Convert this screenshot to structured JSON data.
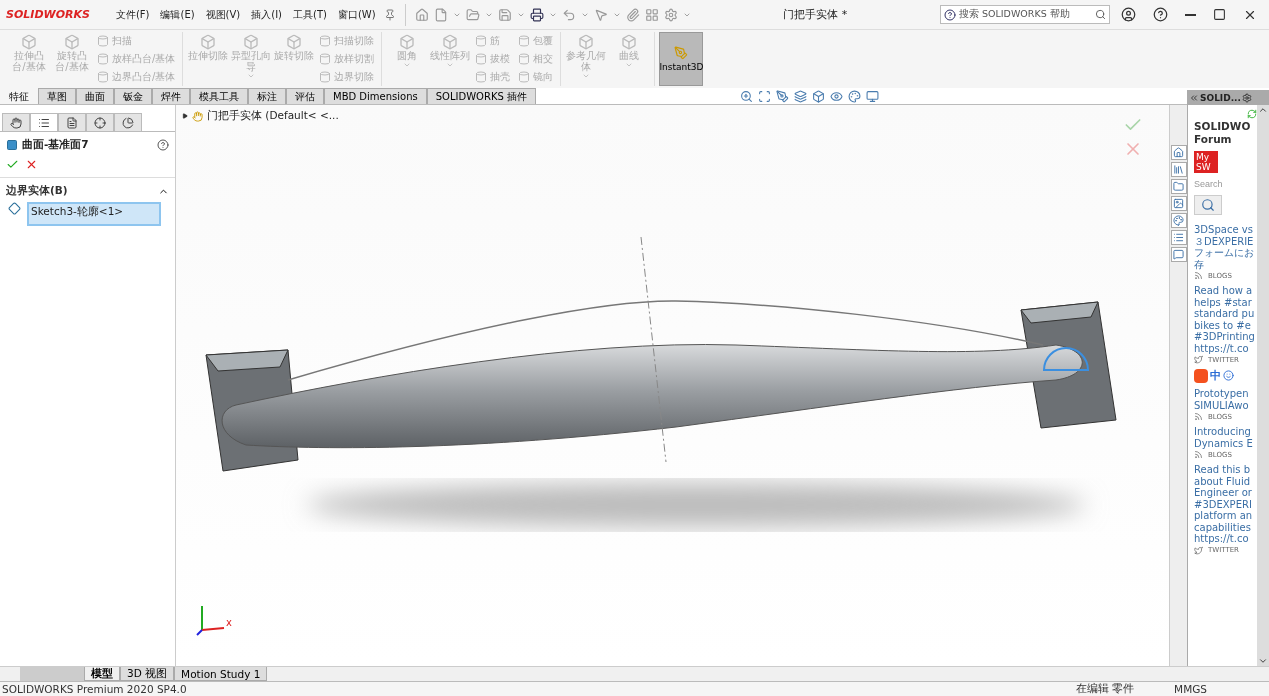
{
  "title_bar": {
    "logo": "SOLIDWORKS",
    "menus": [
      "文件(F)",
      "编辑(E)",
      "视图(V)",
      "插入(I)",
      "工具(T)",
      "窗口(W)"
    ],
    "document_title": "门把手实体 *",
    "search": {
      "placeholder": "搜索 SOLIDWORKS 帮助"
    }
  },
  "ribbon": {
    "groups": [
      {
        "items": [
          {
            "kind": "large",
            "label": "拉伸凸台/基体",
            "disabled": true
          },
          {
            "kind": "large",
            "label": "旋转凸台/基体",
            "disabled": true
          },
          {
            "kind": "small",
            "label": "扫描",
            "disabled": true
          },
          {
            "kind": "small",
            "label": "放样凸台/基体",
            "disabled": true
          },
          {
            "kind": "small",
            "label": "边界凸台/基体",
            "disabled": true
          }
        ]
      },
      {
        "items": [
          {
            "kind": "large",
            "label": "拉伸切除",
            "disabled": true
          },
          {
            "kind": "large",
            "label": "异型孔向导",
            "disabled": true,
            "has_menu": true
          },
          {
            "kind": "large",
            "label": "旋转切除",
            "disabled": true
          },
          {
            "kind": "small",
            "label": "扫描切除",
            "disabled": true
          },
          {
            "kind": "small",
            "label": "放样切割",
            "disabled": true
          },
          {
            "kind": "small",
            "label": "边界切除",
            "disabled": true
          }
        ]
      },
      {
        "items": [
          {
            "kind": "large",
            "label": "圆角",
            "disabled": true,
            "has_menu": true
          },
          {
            "kind": "large",
            "label": "线性阵列",
            "disabled": true,
            "has_menu": true
          },
          {
            "kind": "small",
            "label": "筋",
            "disabled": true
          },
          {
            "kind": "small",
            "label": "拔模",
            "disabled": true
          },
          {
            "kind": "small",
            "label": "抽壳",
            "disabled": true
          },
          {
            "kind": "small",
            "label": "包覆",
            "disabled": true
          },
          {
            "kind": "small",
            "label": "相交",
            "disabled": true
          },
          {
            "kind": "small",
            "label": "镜向",
            "disabled": true
          }
        ]
      },
      {
        "items": [
          {
            "kind": "large",
            "label": "参考几何体",
            "disabled": true,
            "has_menu": true
          },
          {
            "kind": "large",
            "label": "曲线",
            "disabled": true,
            "has_menu": true
          }
        ]
      }
    ],
    "instant3d": {
      "label": "Instant3D",
      "selected": true
    }
  },
  "command_tabs": [
    {
      "label": "特征",
      "selected": true
    },
    {
      "label": "草图",
      "selected": false
    },
    {
      "label": "曲面",
      "selected": false
    },
    {
      "label": "钣金",
      "selected": false
    },
    {
      "label": "焊件",
      "selected": false
    },
    {
      "label": "模具工具",
      "selected": false
    },
    {
      "label": "标注",
      "selected": false
    },
    {
      "label": "评估",
      "selected": false
    },
    {
      "label": "MBD Dimensions",
      "selected": false
    },
    {
      "label": "SOLIDWORKS 插件",
      "selected": false
    }
  ],
  "property_manager": {
    "panel_tabs": [
      {
        "selected": false
      },
      {
        "selected": true
      },
      {
        "selected": false
      },
      {
        "selected": false
      },
      {
        "selected": false
      }
    ],
    "title": "曲面-基准面7",
    "section": {
      "title": "边界实体(B)",
      "expanded": true,
      "items": [
        "Sketch3-轮廓<1>"
      ]
    }
  },
  "viewport": {
    "breadcrumb": "门把手实体  (Default< <...",
    "triad_label": "x"
  },
  "task_pane": {
    "title": "SOLID...",
    "heading": [
      "SOLIDWO",
      "Forum"
    ],
    "logo": [
      "My",
      "SW"
    ],
    "search": {
      "placeholder": "Search"
    },
    "feed": [
      {
        "kind": "blog",
        "lines": [
          "3DSpace vs",
          "３DEXPERIE",
          "フォームにお",
          "存"
        ],
        "source": "BLOGS"
      },
      {
        "kind": "tweet",
        "lines": [
          "Read how a",
          "helps #star",
          "standard pu",
          "bikes to #e",
          "#3DPrinting",
          "https://t.co"
        ],
        "source": "TWITTER"
      },
      {
        "kind": "blog",
        "lines": [
          "Prototypen",
          "SIMULIAwo"
        ],
        "source": "BLOGS"
      },
      {
        "kind": "blog",
        "lines": [
          "Introducing",
          "Dynamics E"
        ],
        "source": "BLOGS"
      },
      {
        "kind": "tweet",
        "lines": [
          "Read this b",
          "about Fluid",
          "Engineer or",
          "#3DEXPERI",
          "platform an",
          "capabilities",
          "https://t.co"
        ],
        "source": "TWITTER"
      }
    ]
  },
  "ime_bar": {
    "label": "中"
  },
  "bottom_tabs": [
    {
      "label": "模型",
      "selected": true
    },
    {
      "label": "3D 视图",
      "selected": false
    },
    {
      "label": "Motion Study 1",
      "selected": false
    }
  ],
  "status_bar": {
    "product": "SOLIDWORKS Premium 2020 SP4.0",
    "mode": "在编辑 零件",
    "units": "MMGS"
  }
}
